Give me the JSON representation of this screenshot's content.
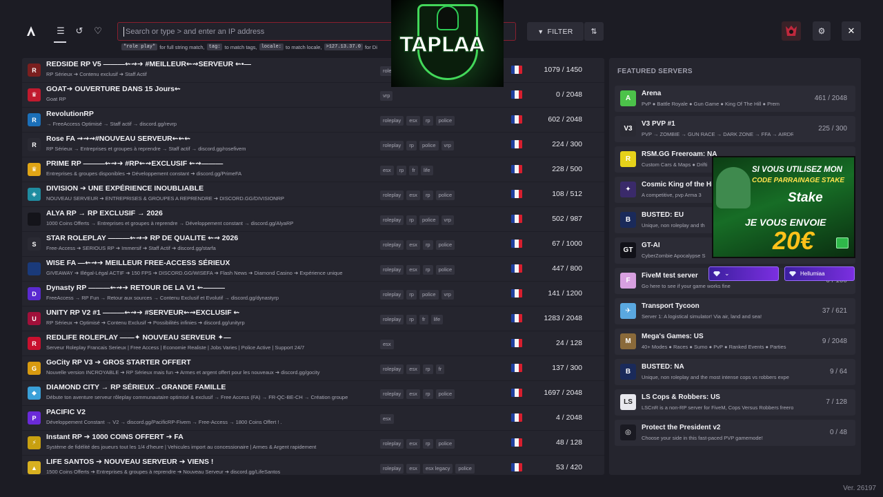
{
  "header": {
    "search_placeholder": "Search or type > and enter an IP address",
    "hints": [
      {
        "code": "\"role play\"",
        "text": "for full string match,"
      },
      {
        "code": "tag:",
        "text": "to match tags,"
      },
      {
        "code": "locale:",
        "text": "to match locale,"
      },
      {
        "code": ">127.13.37.0",
        "text": "for Di"
      }
    ],
    "filter_label": "FILTER"
  },
  "servers": [
    {
      "name": "REDSIDE RP V5 ———⇜⇝➔ #MEILLEUR⇜⇝SERVEUR ⇜•—",
      "desc": "RP Sérieux ➔ Contenu exclusif ➔ Staff Actif",
      "tags": [
        "roleplay"
      ],
      "players": "1079 / 1450",
      "icon_color": "#7a1f1f",
      "icon_text": "R"
    },
    {
      "name": "GOAT➔ OUVERTURE DANS 15 Jours⇜",
      "desc": "Goat RP",
      "tags": [
        "vrp"
      ],
      "players": "0 / 2048",
      "icon_color": "#c01a2e",
      "icon_text": "♛"
    },
    {
      "name": "RevolutionRP",
      "desc": "→ FreeAccess Optimisé → Staff actif → discord.gg/revrp",
      "tags": [
        "roleplay",
        "esx",
        "rp",
        "police"
      ],
      "players": "602 / 2048",
      "icon_color": "#1b6fb8",
      "icon_text": "R"
    },
    {
      "name": "Rose FA ⇝⇝⇝#NOUVEAU SERVEUR⇜⇜⇜",
      "desc": "RP Sérieux → Entreprises et groupes à reprendre → Staff actif → discord.gg/rosefivem",
      "tags": [
        "roleplay",
        "rp",
        "police",
        "vrp"
      ],
      "players": "224 / 300",
      "icon_color": "#2a2a33",
      "icon_text": "R"
    },
    {
      "name": "PRIME RP ———⇜⇝➔ #RP⇜⇝EXCLUSIF ⇜⇝———",
      "desc": "Entreprises & groupes disponibles ➔ Développement constant ➔ discord.gg/PrimeFA",
      "tags": [
        "esx",
        "rp",
        "fr",
        "life"
      ],
      "players": "228 / 500",
      "icon_color": "#e0a516",
      "icon_text": "♛"
    },
    {
      "name": "DIVISION ➔ UNE EXPÉRIENCE INOUBLIABLE",
      "desc": "NOUVEAU SERVEUR ➔ ENTREPRISES & GROUPES A REPRENDRE ➔ DISCORD.GG/DIVISIONRP",
      "tags": [
        "roleplay",
        "esx",
        "rp",
        "police"
      ],
      "players": "108 / 512",
      "icon_color": "#1f8ca0",
      "icon_text": "◈"
    },
    {
      "name": "ALYA RP → RP EXCLUSIF → 2026",
      "desc": "1000 Coins Offerts → Entreprises et groupes à reprendre → Développement constant → discord.gg/AlyaRP",
      "tags": [
        "roleplay",
        "rp",
        "police",
        "vrp"
      ],
      "players": "502 / 987",
      "icon_color": "#14141a",
      "icon_text": ""
    },
    {
      "name": "STAR ROLEPLAY ———⇜⇝➔ RP DE QUALITE ⇜⇝ 2026",
      "desc": "Free-Access ➔ SERIOUS RP ➔ Immersif ➔ Staff Actif ➔ discord.gg/starfa",
      "tags": [
        "roleplay",
        "esx",
        "rp",
        "police"
      ],
      "players": "67 / 1000",
      "icon_color": "#2a2a33",
      "icon_text": "S"
    },
    {
      "name": "WISE FA —⇜⇝➔ MEILLEUR FREE-ACCESS SÉRIEUX",
      "desc": "GIVEAWAY ➔ Illégal-Légal ACTIF ➔ 150 FPS ➔ DISCORD.GG/WISEFA ➔ Flash News ➔ Diamond Casino ➔ Expérience unique",
      "tags": [
        "roleplay",
        "esx",
        "rp",
        "police"
      ],
      "players": "447 / 800",
      "icon_color": "#1a3a7a",
      "icon_text": ""
    },
    {
      "name": "Dynasty RP ———⇜⇝➔ RETOUR DE LA V1 ⇜———",
      "desc": "FreeAccess → RP Fun → Retour aux sources → Contenu Exclusif et Evolutif → discord.gg/dynastyrp",
      "tags": [
        "roleplay",
        "rp",
        "police",
        "vrp"
      ],
      "players": "141 / 1200",
      "icon_color": "#5a2ad0",
      "icon_text": "D"
    },
    {
      "name": "UNITY RP V2 #1 ———⇜⇝➔ #SERVEUR⇜⇝EXCLUSIF ⇜",
      "desc": "RP Sérieux ➔ Optimisé ➔ Contenu Exclusif ➔ Possibilités infinies ➔ discord.gg/unityrp",
      "tags": [
        "roleplay",
        "rp",
        "fr",
        "life"
      ],
      "players": "1283 / 2048",
      "icon_color": "#a0103a",
      "icon_text": "U"
    },
    {
      "name": "REDLIFE ROLEPLAY ——✦ NOUVEAU SERVEUR ✦—",
      "desc": "Serveur Roleplay Francais Serieux | Free Access | Economie Realiste | Jobs Varies | Police Active | Support 24/7",
      "tags": [
        "esx"
      ],
      "players": "24 / 128",
      "icon_color": "#c8102e",
      "icon_text": "R"
    },
    {
      "name": "GoCity RP V3 ➔ GROS STARTER OFFERT",
      "desc": "Nouvelle version INCROYABLE ➔ RP Sérieux mais fun ➔ Armes et argent offert pour les nouveaux ➔ discord.gg/gocity",
      "tags": [
        "roleplay",
        "esx",
        "rp",
        "fr"
      ],
      "players": "137 / 300",
      "icon_color": "#d89a10",
      "icon_text": "G"
    },
    {
      "name": "DIAMOND CITY → RP SÉRIEUX→GRANDE FAMILLE",
      "desc": "Débute ton aventure serveur rôleplay communautaire optimisé & exclusif → Free Access (FA) → FR-QC-BE-CH → Création groupe",
      "tags": [
        "roleplay",
        "esx",
        "rp",
        "police"
      ],
      "players": "1697 / 2048",
      "icon_color": "#3aa0d8",
      "icon_text": "◆"
    },
    {
      "name": "PACIFIC V2",
      "desc": "Développement Constant → V2 → discord.gg/PacificRP-Fivem → Free-Access → 1800 Coins Offert ! .",
      "tags": [
        "esx"
      ],
      "players": "4 / 2048",
      "icon_color": "#6a2ad8",
      "icon_text": "P"
    },
    {
      "name": "Instant RP ➔ 1000 COINS OFFERT ➔ FA",
      "desc": "Système de fidélité des joueurs tout les 1/4 d'heure | Vehicules import au concessionaire | Armes & Argent rapidement",
      "tags": [
        "roleplay",
        "esx",
        "rp",
        "police"
      ],
      "players": "48 / 128",
      "icon_color": "#c8a010",
      "icon_text": "⚡"
    },
    {
      "name": "LIFE SANTOS ➔ NOUVEAU SERVEUR ➔ VIENS !",
      "desc": "1500 Coins Offerts ➔ Entreprises & groupes à reprendre ➔ Nouveau Serveur ➔ discord.gg/LifeSantos",
      "tags": [
        "roleplay",
        "esx",
        "esx legacy",
        "police"
      ],
      "players": "53 / 420",
      "icon_color": "#d8b020",
      "icon_text": "▲"
    }
  ],
  "featured": {
    "title": "FEATURED SERVERS",
    "items": [
      {
        "name": "Arena",
        "desc": "PvP ● Battle Royale ● Gun Game ● King Of The Hill ● Prem",
        "players": "461 / 2048",
        "icon_color": "#4cc24a",
        "icon_text": "A"
      },
      {
        "name": "V3 PVP #1",
        "desc": "PVP → ZOMBIE → GUN RACE → DARK ZONE → FFA → AIRDR",
        "players": "225 / 300",
        "icon_color": "#2a2a33",
        "icon_text": "V3"
      },
      {
        "name": "RSM.GG Freeroam: NA",
        "desc": "Custom Cars & Maps ● Drifti",
        "players": "",
        "icon_color": "#e6d21a",
        "icon_text": "R"
      },
      {
        "name": "Cosmic King of the Hi",
        "desc": "A competitive, pvp Arma 3",
        "players": "",
        "icon_color": "#3a2a6a",
        "icon_text": "✦"
      },
      {
        "name": "BUSTED: EU",
        "desc": "Unique, non roleplay and th",
        "players": "",
        "icon_color": "#1a2a5a",
        "icon_text": "B"
      },
      {
        "name": "GT-AI",
        "desc": "CyberZombie Apocalypse S",
        "players": "",
        "icon_color": "#111118",
        "icon_text": "GT"
      },
      {
        "name": "FiveM test server",
        "desc": "Go here to see if your game works fine",
        "players": "0 / 100",
        "icon_color": "#d8a0e0",
        "icon_text": "F"
      },
      {
        "name": "Transport Tycoon",
        "desc": "Server 1: A logistical simulator! Via air, land and sea!",
        "players": "37 / 621",
        "icon_color": "#5aa8e0",
        "icon_text": "✈"
      },
      {
        "name": "Mega's Games: US",
        "desc": "40+ Modes ● Races ● Sumo ● PvP ● Ranked Events ● Parties",
        "players": "9 / 2048",
        "icon_color": "#8a6a3a",
        "icon_text": "M"
      },
      {
        "name": "BUSTED: NA",
        "desc": "Unique, non roleplay and the most intense cops vs robbers expe",
        "players": "9 / 64",
        "icon_color": "#1a2a5a",
        "icon_text": "B"
      },
      {
        "name": "LS Cops & Robbers: US",
        "desc": "LSCnR is a non-RP server for FiveM, Cops Versus Robbers freero",
        "players": "7 / 128",
        "icon_color": "#e8e8ee",
        "icon_text": "LS"
      },
      {
        "name": "Protect the President v2",
        "desc": "Choose your side in this fast-paced PVP gamemode!",
        "players": "0 / 48",
        "icon_color": "#1a1a22",
        "icon_text": "◎"
      }
    ]
  },
  "overlays": {
    "taplaa_text": "TAPLAA",
    "ad_line1": "SI VOUS UTILISEZ MON",
    "ad_line2": "CODE PARRAINAGE STAKE",
    "ad_brand": "Stake",
    "ad_line3": "JE VOUS ENVOIE",
    "ad_amount": "20€",
    "ad_button2": "Hellumiaa"
  },
  "version": "Ver. 26197"
}
